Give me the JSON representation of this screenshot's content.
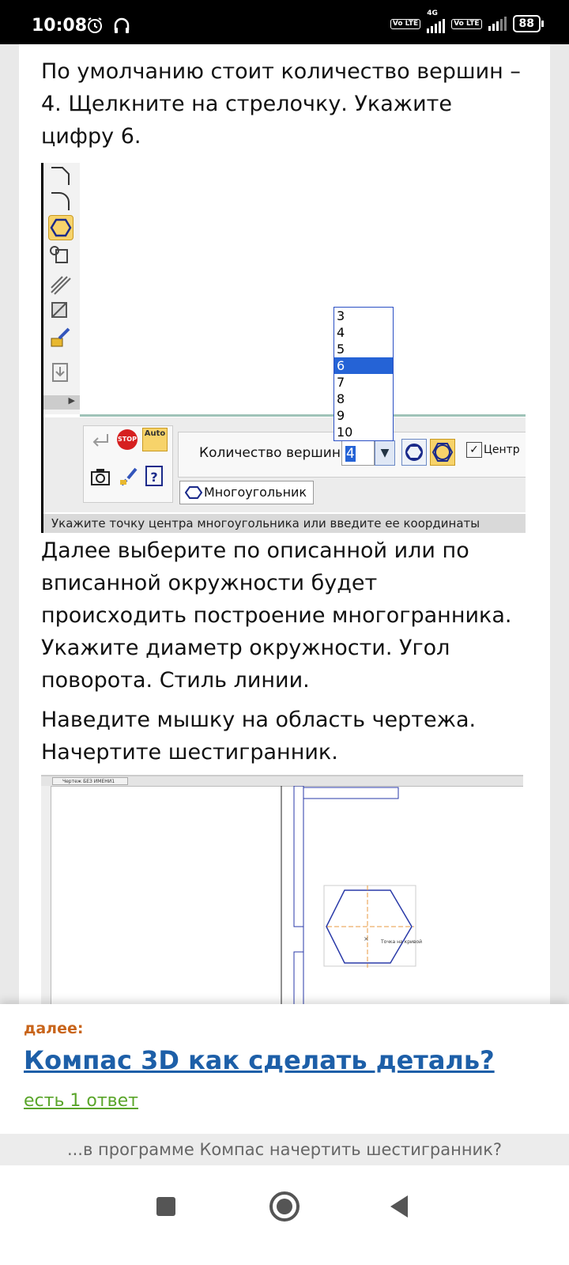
{
  "status_bar": {
    "time": "10:08",
    "volte1": "Vo LTE",
    "network": "4G",
    "volte2": "Vo LTE",
    "battery": "88"
  },
  "article": {
    "para1": "По умолчанию стоит количество вершин – 4. Щелкните на стрелочку. Укажите цифру 6.",
    "para2": "Далее выберите по описанной или по вписанной окружности будет происходить построение многогранника. Укажите диаметр окружности. Угол поворота. Стиль линии.",
    "para3": "Наведите мышку на область чертежа. Начертите шестигранник."
  },
  "screenshot1": {
    "dropdown_options": [
      "3",
      "4",
      "5",
      "6",
      "7",
      "8",
      "9",
      "10"
    ],
    "dropdown_selected": "6",
    "field_label": "Количество вершин",
    "field_value": "4",
    "center_checkbox": "Центр",
    "tab_label": "Многоугольник",
    "hint": "Укажите точку центра многоугольника или введите ее координаты",
    "stop_label": "STOP",
    "auto_label": "Auto"
  },
  "screenshot2": {
    "tab_label": "Чертеж БЕЗ ИМЕНИ1",
    "point_label": "Точка на кривой"
  },
  "bottom_sheet": {
    "next_label": "далее:",
    "next_title": "Компас 3D как сделать деталь?",
    "answers_link": "есть 1 ответ",
    "related_text": "...в программе Компас начертить шестигранник?"
  },
  "colors": {
    "selection": "#2563d6",
    "active_tool": "#f7d36a",
    "next_label": "#c8641a",
    "link": "#1d5fa8",
    "answers": "#5aa52a"
  }
}
